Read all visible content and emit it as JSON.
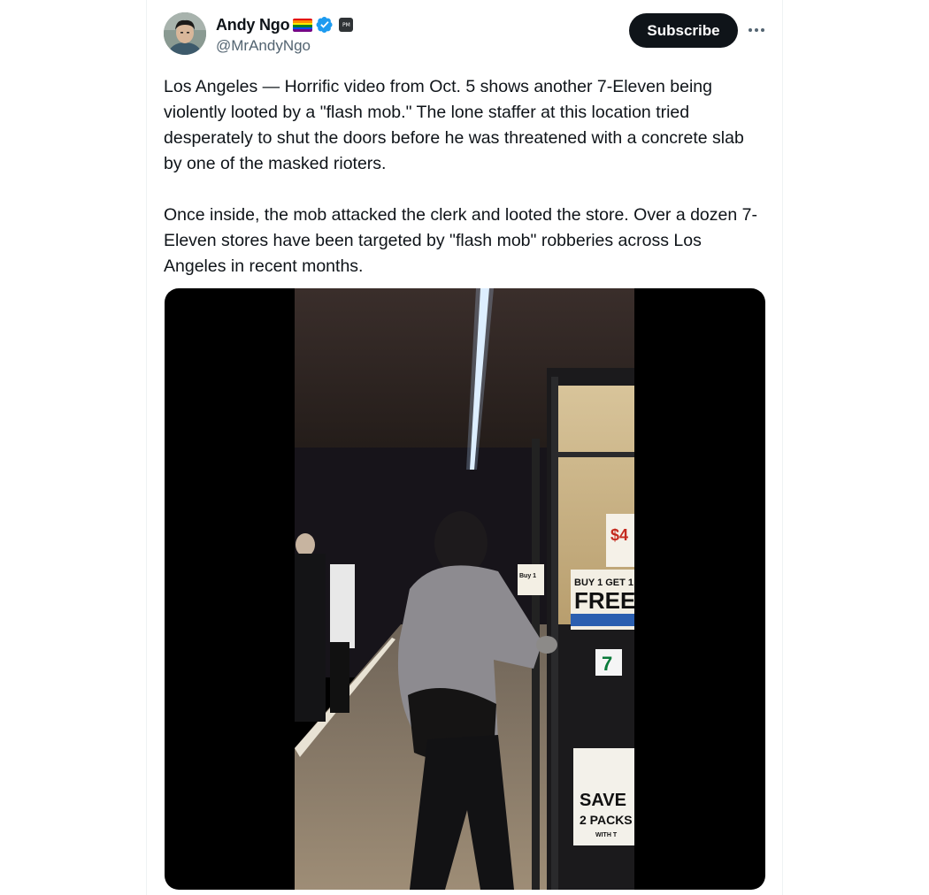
{
  "author": {
    "display_name": "Andy Ngo",
    "handle": "@MrAndyNgo",
    "affiliate_badge_text": "PM",
    "flag_colors": [
      "#e40303",
      "#ff8c00",
      "#ffed00",
      "#008026",
      "#004dff",
      "#750787"
    ],
    "verified_color": "#1d9bf0"
  },
  "actions": {
    "subscribe_label": "Subscribe",
    "more_icon": "more-horizontal-icon"
  },
  "tweet": {
    "paragraphs": [
      "Los Angeles — Horrific video from Oct. 5 shows another 7-Eleven being violently looted by a \"flash mob.\" The lone staffer at this location tried desperately to shut the doors before he was threatened with a concrete slab by one of the masked rioters.",
      "Once inside, the mob attacked the clerk and looted the store. Over a dozen 7-Eleven stores have been targeted by \"flash mob\" robberies across Los Angeles in recent months."
    ]
  },
  "video_frame": {
    "signs": {
      "price": "$4",
      "promo_small": "Buy 1",
      "promo_top": "BUY 1 GET 1",
      "promo_big": "FREE",
      "save_top": "SAVE",
      "save_mid": "2 PACKS",
      "save_bottom": "WITH T"
    }
  }
}
